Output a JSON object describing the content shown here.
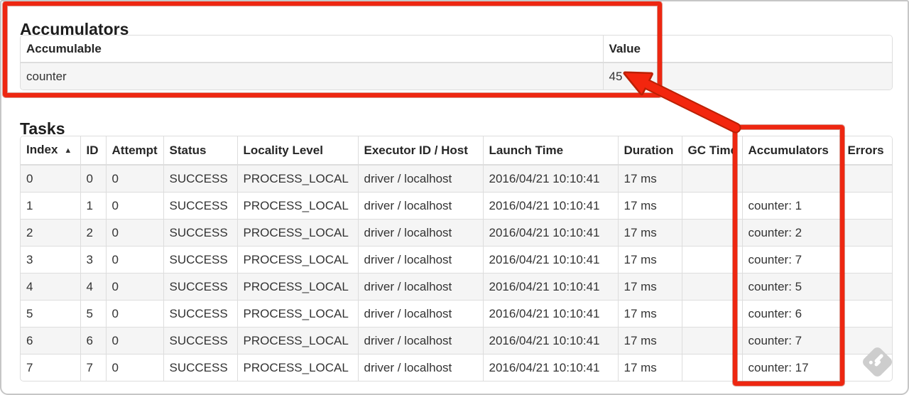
{
  "colors": {
    "annotation_red": "#ee2711",
    "table_border": "#dddddd",
    "stripe_row": "#f5f5f5",
    "text": "#333333"
  },
  "icons": {
    "sort_ascending": "▲",
    "watermark": "skitch-stamp"
  },
  "accumulators_section": {
    "heading": "Accumulators",
    "table": {
      "headers": [
        "Accumulable",
        "Value"
      ],
      "rows": [
        [
          "counter",
          "45"
        ]
      ]
    }
  },
  "tasks_section": {
    "heading": "Tasks",
    "sort_column": "Index",
    "table": {
      "headers": [
        "Index",
        "ID",
        "Attempt",
        "Status",
        "Locality Level",
        "Executor ID / Host",
        "Launch Time",
        "Duration",
        "GC Time",
        "Accumulators",
        "Errors"
      ],
      "rows": [
        [
          "0",
          "0",
          "0",
          "SUCCESS",
          "PROCESS_LOCAL",
          "driver / localhost",
          "2016/04/21 10:10:41",
          "17 ms",
          "",
          "",
          ""
        ],
        [
          "1",
          "1",
          "0",
          "SUCCESS",
          "PROCESS_LOCAL",
          "driver / localhost",
          "2016/04/21 10:10:41",
          "17 ms",
          "",
          "counter: 1",
          ""
        ],
        [
          "2",
          "2",
          "0",
          "SUCCESS",
          "PROCESS_LOCAL",
          "driver / localhost",
          "2016/04/21 10:10:41",
          "17 ms",
          "",
          "counter: 2",
          ""
        ],
        [
          "3",
          "3",
          "0",
          "SUCCESS",
          "PROCESS_LOCAL",
          "driver / localhost",
          "2016/04/21 10:10:41",
          "17 ms",
          "",
          "counter: 7",
          ""
        ],
        [
          "4",
          "4",
          "0",
          "SUCCESS",
          "PROCESS_LOCAL",
          "driver / localhost",
          "2016/04/21 10:10:41",
          "17 ms",
          "",
          "counter: 5",
          ""
        ],
        [
          "5",
          "5",
          "0",
          "SUCCESS",
          "PROCESS_LOCAL",
          "driver / localhost",
          "2016/04/21 10:10:41",
          "17 ms",
          "",
          "counter: 6",
          ""
        ],
        [
          "6",
          "6",
          "0",
          "SUCCESS",
          "PROCESS_LOCAL",
          "driver / localhost",
          "2016/04/21 10:10:41",
          "17 ms",
          "",
          "counter: 7",
          ""
        ],
        [
          "7",
          "7",
          "0",
          "SUCCESS",
          "PROCESS_LOCAL",
          "driver / localhost",
          "2016/04/21 10:10:41",
          "17 ms",
          "",
          "counter: 17",
          ""
        ]
      ]
    }
  }
}
